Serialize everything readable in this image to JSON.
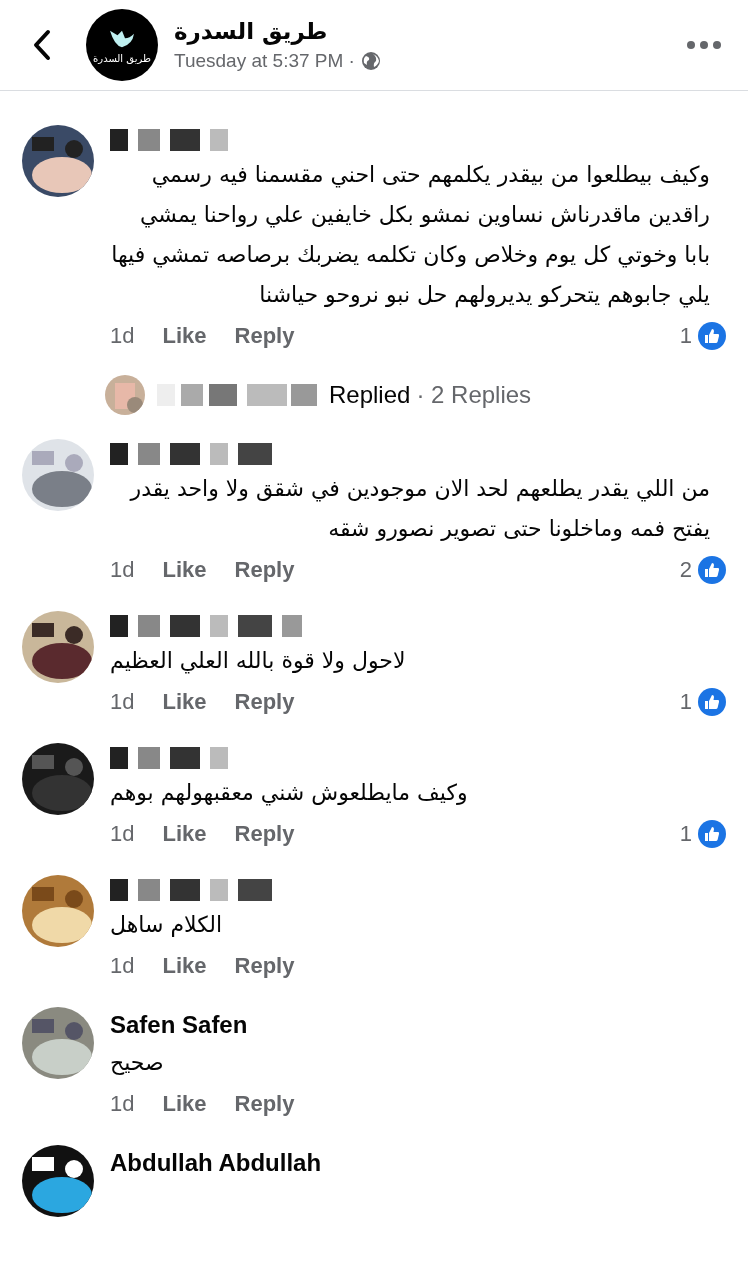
{
  "header": {
    "page_name": "طريق السدرة",
    "logo_text": "طريق السدرة",
    "timestamp": "Tuesday at 5:37 PM ·"
  },
  "comments": [
    {
      "author": {
        "kind": "redacted"
      },
      "text": "وكيف بيطلعوا من بيقدر يكلمهم حتى احني مقسمنا فيه رسمي راقدين ماقدرناش نساوين نمشو بكل خايفين علي رواحنا يمشي بابا وخوتي كل يوم وخلاص وكان تكلمه يضربك برصاصه تمشي فيها يلي جابوهم يتحركو يديرولهم حل نبو نروحو حياشنا",
      "time": "1d",
      "like": "Like",
      "reply": "Reply",
      "likes": "1",
      "replies": {
        "label": "Replied",
        "count": "· 2 Replies"
      }
    },
    {
      "author": {
        "kind": "redacted"
      },
      "text": "من اللي يقدر يطلعهم لحد الان موجودين في شقق ولا واحد يقدر يفتح فمه وماخلونا حتى تصوير نصورو شقه",
      "time": "1d",
      "like": "Like",
      "reply": "Reply",
      "likes": "2"
    },
    {
      "author": {
        "kind": "redacted"
      },
      "text": "لاحول ولا قوة بالله العلي العظيم",
      "time": "1d",
      "like": "Like",
      "reply": "Reply",
      "likes": "1"
    },
    {
      "author": {
        "kind": "redacted"
      },
      "text": "وكيف مايطلعوش شني معقبهولهم بوهم",
      "time": "1d",
      "like": "Like",
      "reply": "Reply",
      "likes": "1"
    },
    {
      "author": {
        "kind": "redacted"
      },
      "text": "الكلام ساهل",
      "time": "1d",
      "like": "Like",
      "reply": "Reply"
    },
    {
      "author": {
        "kind": "name",
        "name": "Safen Safen"
      },
      "text": "صحيح",
      "time": "1d",
      "like": "Like",
      "reply": "Reply"
    },
    {
      "author": {
        "kind": "name",
        "name": "Abdullah Abdullah"
      }
    }
  ]
}
